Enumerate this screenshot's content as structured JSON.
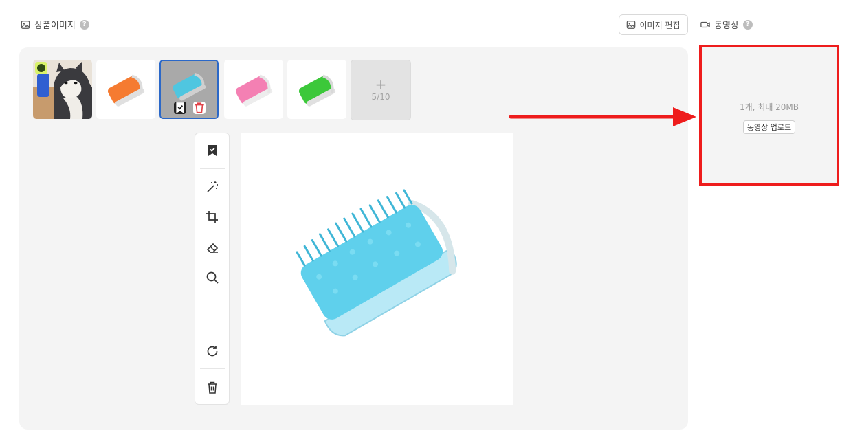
{
  "product_images": {
    "title": "상품이미지",
    "help": "?",
    "edit_label": "이미지 편집",
    "thumbnails": [
      {
        "name": "cat-brush",
        "representative": true
      },
      {
        "name": "orange-brush"
      },
      {
        "name": "blue-brush",
        "selected": true
      },
      {
        "name": "pink-brush"
      },
      {
        "name": "green-brush"
      }
    ],
    "add_slot": {
      "plus": "+",
      "count": "5/10"
    }
  },
  "video": {
    "title": "동영상",
    "help": "?",
    "limit_text": "1개, 최대 20MB",
    "upload_label": "동영상 업로드"
  },
  "colors": {
    "highlight": "#ee1c1c",
    "selected_border": "#2b68c8",
    "representative_badge": "#d9f36a",
    "brush_blue": "#5fd0ec",
    "brush_orange": "#f57b31",
    "brush_pink": "#f480b3",
    "brush_green": "#3cc83a"
  },
  "icons": {
    "tools": [
      "bookmark-check-icon",
      "magic-wand-icon",
      "crop-icon",
      "eraser-icon",
      "search-icon",
      "rotate-icon",
      "trash-icon"
    ]
  }
}
